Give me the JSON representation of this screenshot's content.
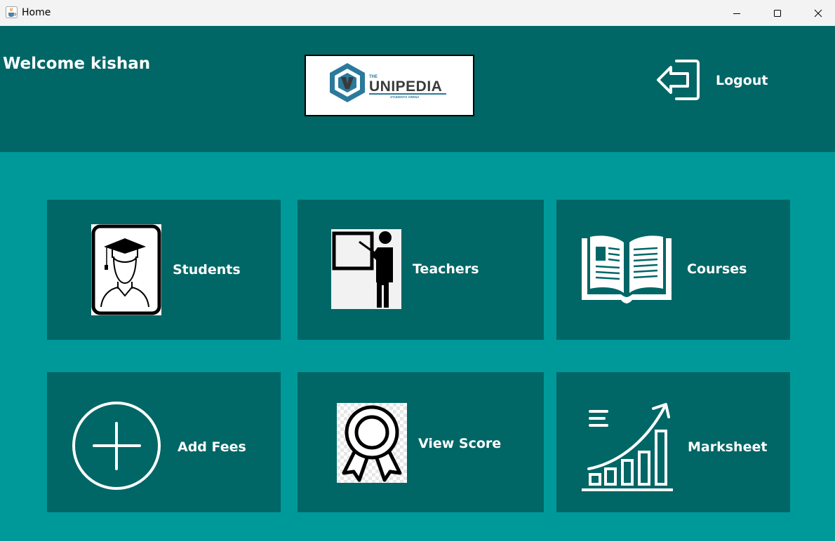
{
  "window": {
    "title": "Home",
    "app_icon": "java-cup-icon",
    "controls": [
      "minimize-icon",
      "maximize-icon",
      "close-icon"
    ]
  },
  "header": {
    "welcome_text": "Welcome kishan",
    "logo": {
      "brand": "UNIPEDIA",
      "prefix": "THE",
      "tagline": "STUDENTS ARENA"
    },
    "logout_label": "Logout",
    "logout_icon": "logout-icon"
  },
  "tiles": [
    {
      "label": "Students",
      "icon": "student-graduate-icon"
    },
    {
      "label": "Teachers",
      "icon": "teacher-board-icon"
    },
    {
      "label": "Courses",
      "icon": "open-book-icon"
    },
    {
      "label": "Add Fees",
      "icon": "plus-circle-icon"
    },
    {
      "label": "View Score",
      "icon": "award-ribbon-icon"
    },
    {
      "label": "Marksheet",
      "icon": "growth-chart-icon"
    }
  ],
  "colors": {
    "background": "#009999",
    "panel": "#006666",
    "titlebar": "#f3f3f3",
    "text": "#ffffff",
    "logo_blue": "#2a7a9b",
    "logo_dark": "#3a3a3a"
  }
}
